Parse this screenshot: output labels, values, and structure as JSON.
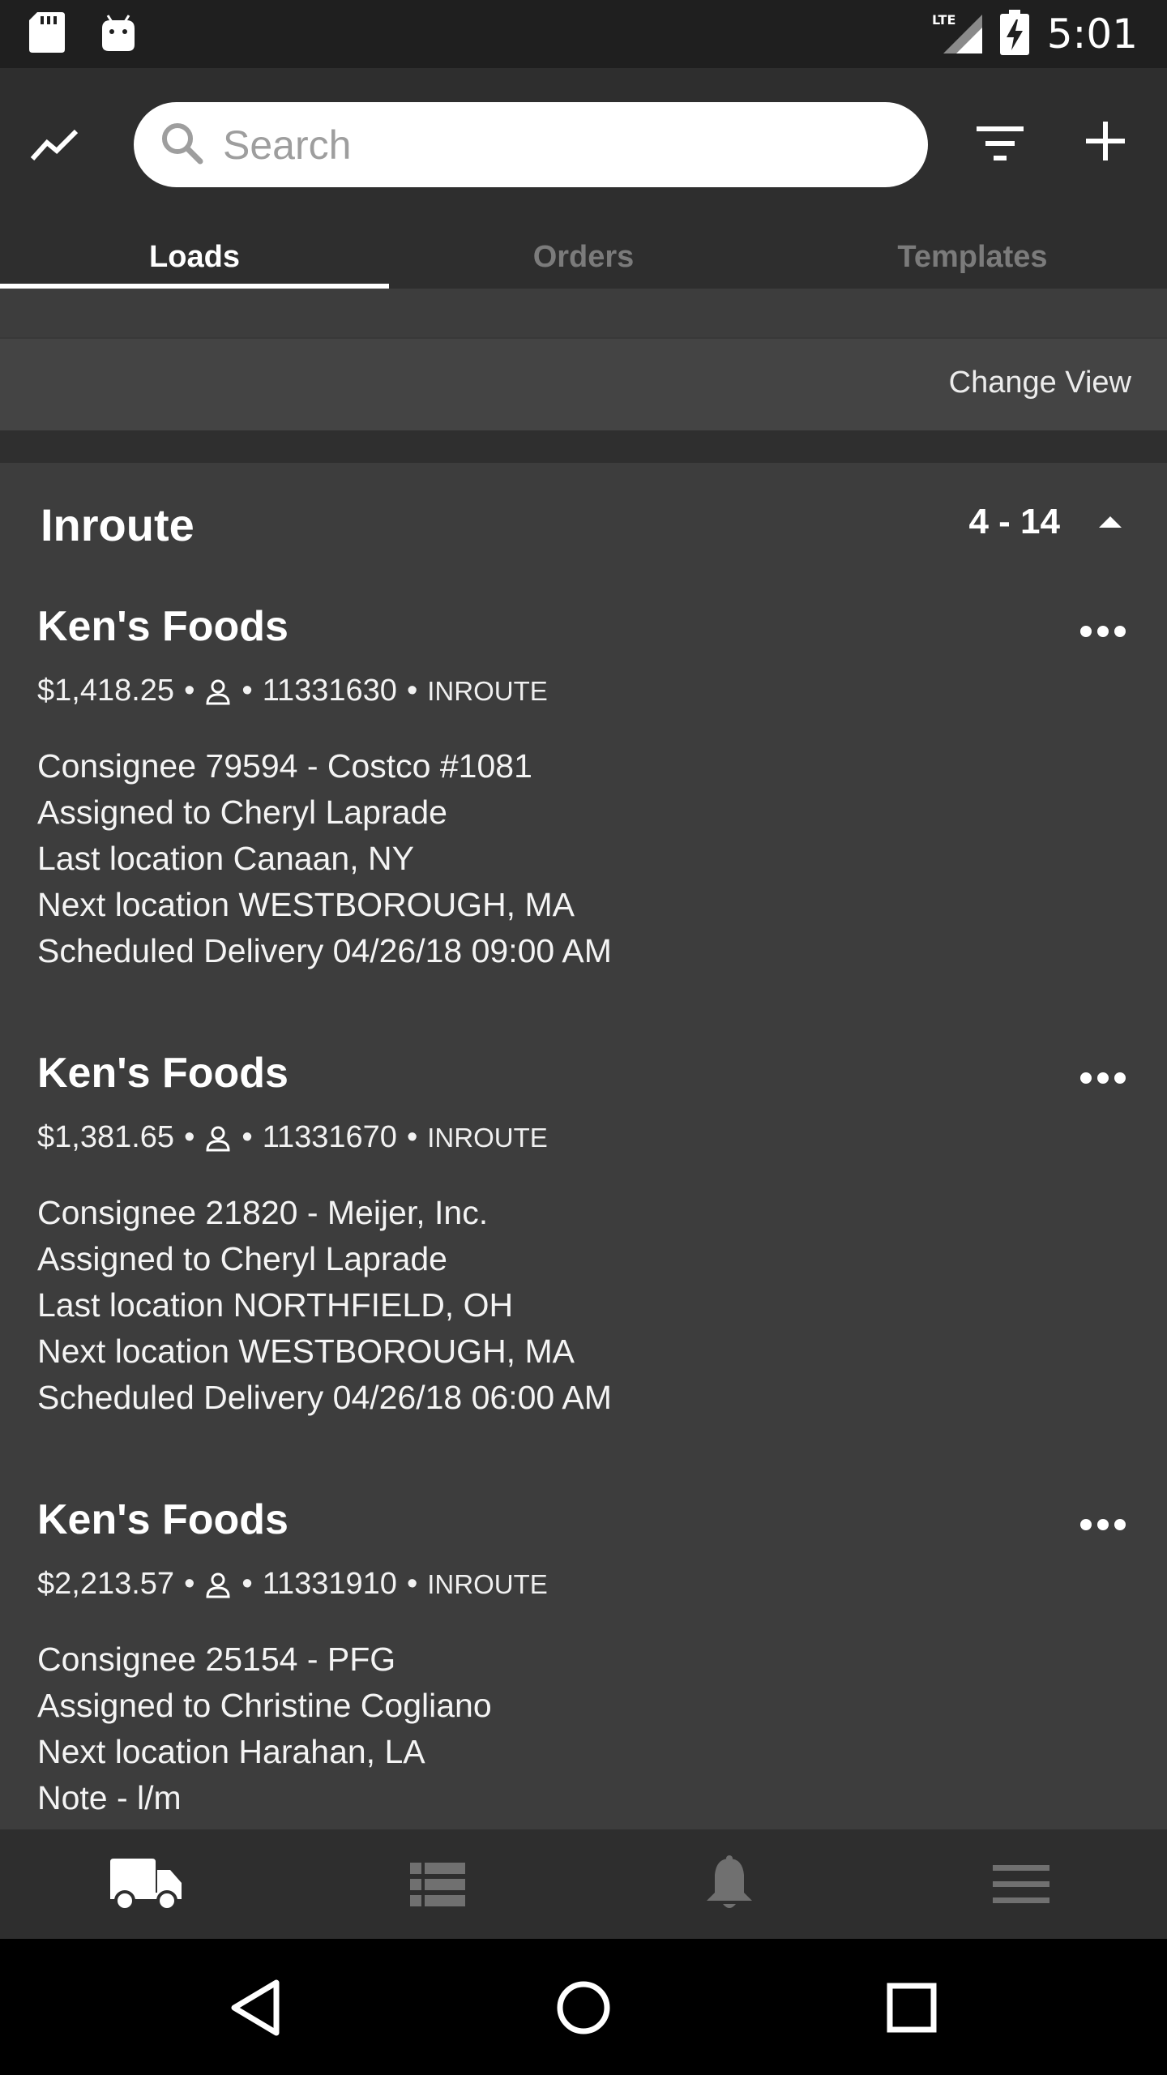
{
  "status_bar": {
    "time": "5:01",
    "network": "LTE",
    "icons": [
      "sd-card-icon",
      "android-icon",
      "lte-signal-icon",
      "battery-charging-icon"
    ]
  },
  "app_bar": {
    "search": {
      "placeholder": "Search",
      "value": ""
    },
    "icons": {
      "left": "trend-icon",
      "filter": "filter-icon",
      "add": "plus-icon"
    },
    "tabs": [
      {
        "label": "Loads",
        "active": true
      },
      {
        "label": "Orders",
        "active": false
      },
      {
        "label": "Templates",
        "active": false
      }
    ]
  },
  "change_view": {
    "label": "Change View"
  },
  "section": {
    "title": "Inroute",
    "count": "4 - 14",
    "icon": "collapse-arrow-icon"
  },
  "loads": [
    {
      "title": "Ken's Foods",
      "amount": "$1,418.25",
      "id": "11331630",
      "status": "INROUTE",
      "lines": [
        "Consignee 79594 - Costco #1081",
        "Assigned to Cheryl Laprade",
        "Last location Canaan, NY",
        "Next location WESTBOROUGH, MA",
        "Scheduled Delivery 04/26/18 09:00 AM"
      ]
    },
    {
      "title": "Ken's Foods",
      "amount": "$1,381.65",
      "id": "11331670",
      "status": "INROUTE",
      "lines": [
        "Consignee 21820 - Meijer, Inc.",
        "Assigned to Cheryl Laprade",
        "Last location NORTHFIELD, OH",
        "Next location WESTBOROUGH, MA",
        "Scheduled Delivery 04/26/18 06:00 AM"
      ]
    },
    {
      "title": "Ken's Foods",
      "amount": "$2,213.57",
      "id": "11331910",
      "status": "INROUTE",
      "lines": [
        "Consignee 25154 - PFG",
        "Assigned to Christine Cogliano",
        "Next location Harahan, LA",
        "Note - l/m"
      ]
    }
  ],
  "bottom_nav": [
    {
      "icon": "truck-icon",
      "active": true
    },
    {
      "icon": "list-icon",
      "active": false
    },
    {
      "icon": "bell-icon",
      "active": false
    },
    {
      "icon": "menu-icon",
      "active": false
    }
  ],
  "system_nav": [
    "back-icon",
    "home-icon",
    "recents-icon"
  ],
  "colors": {
    "status_bar_bg": "#1f1f1f",
    "app_bar_bg": "#2e2e2e",
    "content_bg": "#3d3d3d",
    "active_text": "#ffffff",
    "inactive_tab": "#7b7b7b"
  }
}
